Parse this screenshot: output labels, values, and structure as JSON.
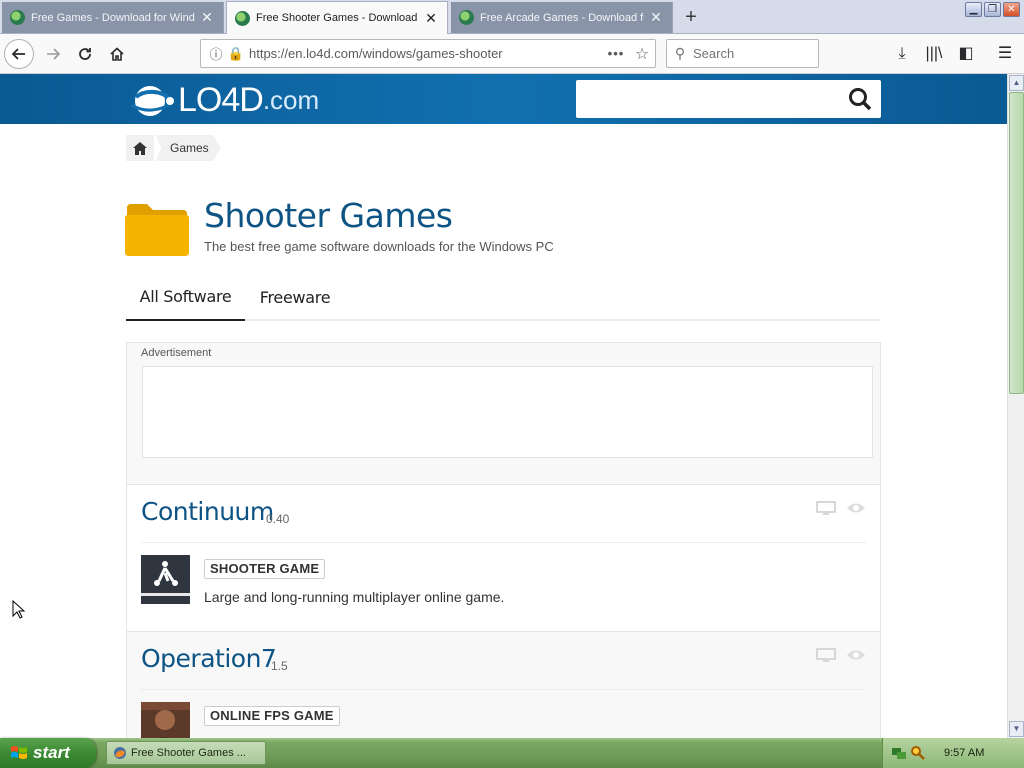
{
  "browser": {
    "tabs": [
      {
        "title": "Free Games - Download for Windows",
        "active": false
      },
      {
        "title": "Free Shooter Games - Download for Windows",
        "active": true
      },
      {
        "title": "Free Arcade Games - Download for Windows",
        "active": false
      }
    ],
    "url": "https://en.lo4d.com/windows/games-shooter",
    "search_placeholder": "Search",
    "new_tab": "+"
  },
  "site": {
    "logo_text": "LO4D",
    "logo_tld": ".com",
    "breadcrumb": [
      "Games"
    ]
  },
  "page": {
    "title": "Shooter Games",
    "subtitle": "The best free game software downloads for the Windows PC",
    "tabs": [
      "All Software",
      "Freeware"
    ],
    "ad_label": "Advertisement"
  },
  "items": [
    {
      "name": "Continuum",
      "version": "0.40",
      "category": "SHOOTER GAME",
      "description": "Large and long-running multiplayer online game."
    },
    {
      "name": "Operation7",
      "version": "1.5",
      "category": "ONLINE FPS GAME",
      "description": ""
    }
  ],
  "taskbar": {
    "start_label": "start",
    "task_title": "Free Shooter Games ...",
    "clock": "9:57 AM"
  },
  "colors": {
    "header_blue": "#1270b0",
    "title_blue": "#0d5485",
    "folder_yellow": "#f5b400"
  }
}
